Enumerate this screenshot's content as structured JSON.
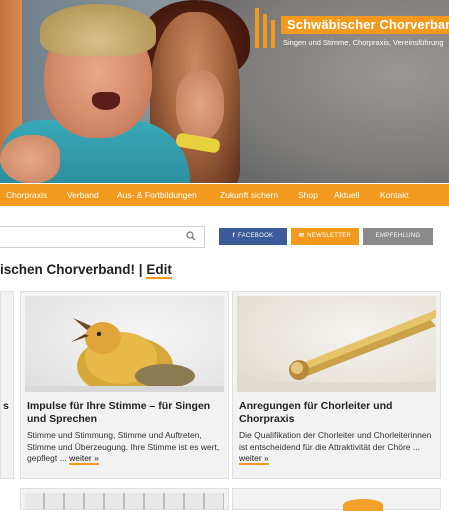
{
  "logo": {
    "title": "Schwäbischer Chorverband",
    "subtitle": "Singen und Stimme, Chorpraxis, Vereinsführung"
  },
  "nav": {
    "items": [
      "Chorpraxis",
      "Verband",
      "Aus- & Fortbildungen",
      "Zukunft sichern",
      "Shop",
      "Aktuell",
      "Kontakt"
    ]
  },
  "search": {
    "placeholder": ""
  },
  "social": {
    "facebook": "FACEBOOK",
    "newsletter": "NEWSLETTER",
    "empfehlung": "EMPFEHLUNG"
  },
  "headline": {
    "text": "ischen Chorverband!",
    "separator": "|",
    "edit": "Edit"
  },
  "cards": [
    {
      "title": "Impulse für Ihre Stimme – für Singen und Sprechen",
      "text": "Stimme und Stimmung, Stimme und Auftreten, Stimme und Überzeugung. Ihre Stimme ist es wert, gepflegt ...",
      "more": "weiter »"
    },
    {
      "title": "Anregungen für Chorleiter und Chorpraxis",
      "text": "Die Qualifikation der Chorleiter und Chorleiterinnen ist entscheidend für die Attraktivität der Chöre ...",
      "more": "weiter »"
    }
  ],
  "left_card": {
    "title_fragment": "s"
  },
  "colors": {
    "accent": "#f29a1e",
    "facebook": "#3a5a9a",
    "gray": "#8a8a8a"
  },
  "icons": [
    "search-icon",
    "facebook-icon",
    "newsletter-icon"
  ]
}
